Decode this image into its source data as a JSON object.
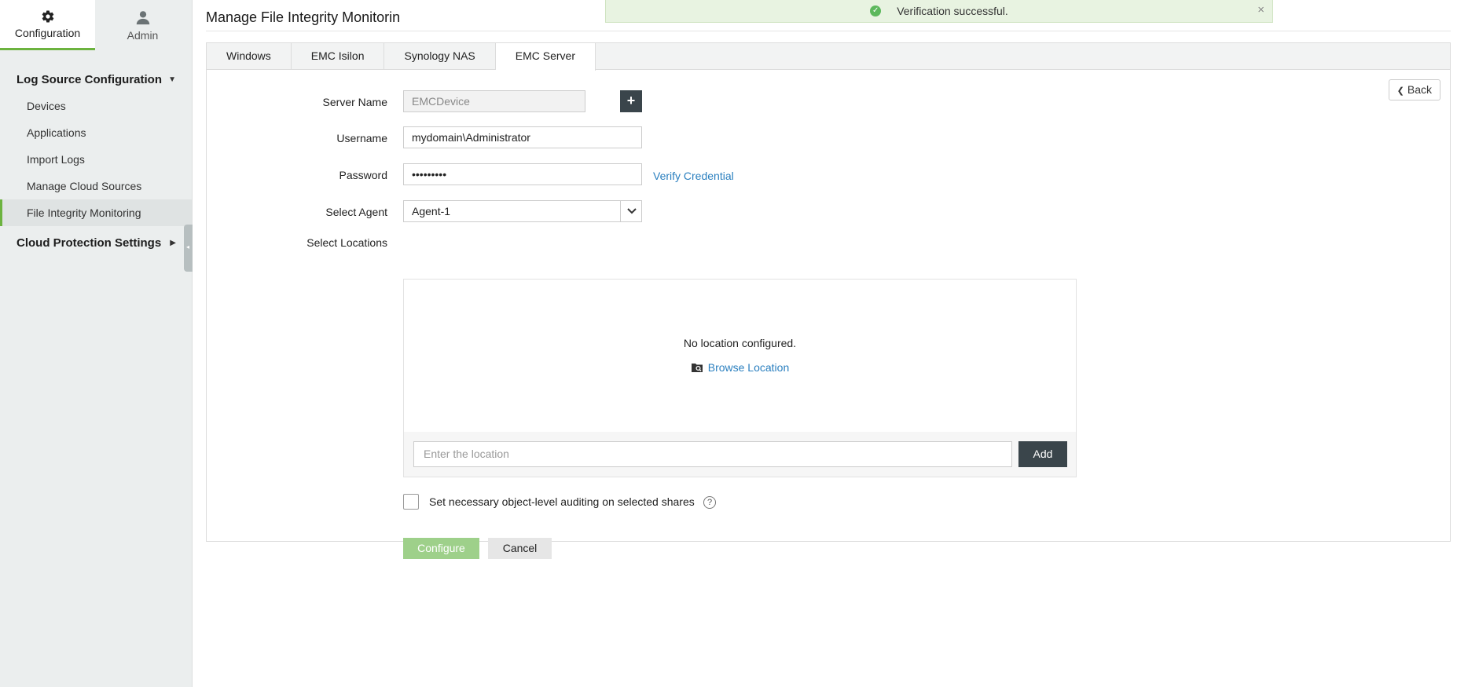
{
  "sidebar": {
    "topnav": [
      {
        "label": "Configuration",
        "icon": "gear-icon",
        "active": true
      },
      {
        "label": "Admin",
        "icon": "user-icon",
        "active": false
      }
    ],
    "sections": {
      "log_source": "Log Source Configuration",
      "cloud": "Cloud Protection Settings"
    },
    "items": [
      {
        "label": "Devices"
      },
      {
        "label": "Applications"
      },
      {
        "label": "Import Logs"
      },
      {
        "label": "Manage Cloud Sources"
      },
      {
        "label": "File Integrity Monitoring",
        "active": true
      }
    ]
  },
  "page": {
    "title": "Manage File Integrity Monitorin"
  },
  "toast": {
    "message": "Verification successful.",
    "close": "×"
  },
  "tabs": [
    {
      "label": "Windows"
    },
    {
      "label": "EMC Isilon"
    },
    {
      "label": "Synology NAS"
    },
    {
      "label": "EMC Server",
      "active": true
    }
  ],
  "back_label": "Back",
  "form": {
    "server_name": {
      "label": "Server Name",
      "placeholder": "EMCDevice"
    },
    "username": {
      "label": "Username",
      "value": "mydomain\\Administrator"
    },
    "password": {
      "label": "Password",
      "value": "•••••••••"
    },
    "verify_link": "Verify Credential",
    "agent": {
      "label": "Select Agent",
      "value": "Agent-1"
    },
    "locations": {
      "label": "Select Locations",
      "empty_text": "No location configured.",
      "browse_link": "Browse Location",
      "input_placeholder": "Enter the location",
      "add_label": "Add"
    },
    "auditing_label": "Set necessary object-level auditing on selected shares",
    "help": "?",
    "configure_label": "Configure",
    "cancel_label": "Cancel"
  },
  "colors": {
    "accent": "#6cb33f",
    "dark_button": "#3a454b",
    "link": "#2a7fbf",
    "toast_bg": "#e8f3e1"
  }
}
